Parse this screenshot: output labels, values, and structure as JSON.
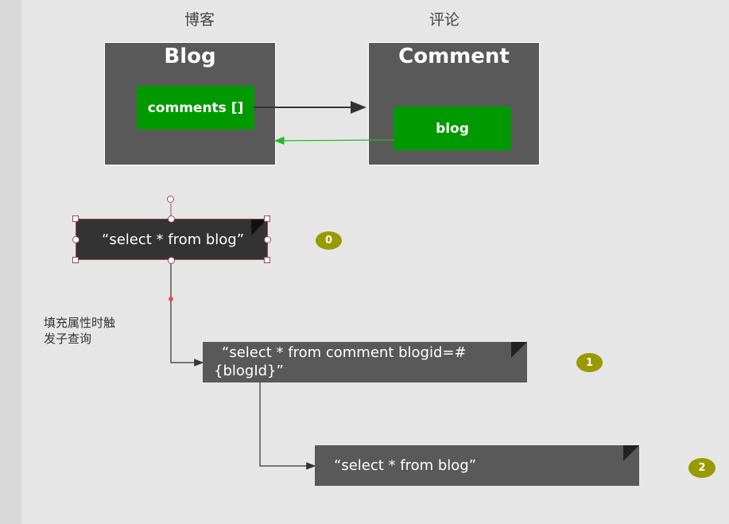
{
  "labels": {
    "blog_header": "博客",
    "comment_header": "评论",
    "side_note_line1": "填充属性时触",
    "side_note_line2": "发子查询"
  },
  "entities": {
    "blog": {
      "title": "Blog",
      "field": "comments []"
    },
    "comment": {
      "title": "Comment",
      "field": "blog"
    }
  },
  "queries": [
    {
      "text": "“select * from blog”",
      "badge": "0"
    },
    {
      "line1": "“select * from comment blogid=#",
      "line2": "{blogId}”",
      "badge": "1"
    },
    {
      "text": "“select * from blog”",
      "badge": "2"
    }
  ],
  "colors": {
    "entity_bg": "#595959",
    "field_green": "#009900",
    "badge_olive": "#999900",
    "selected_note_bg": "#333333",
    "note_bg": "#595959",
    "back_arrow": "#22bb22"
  }
}
